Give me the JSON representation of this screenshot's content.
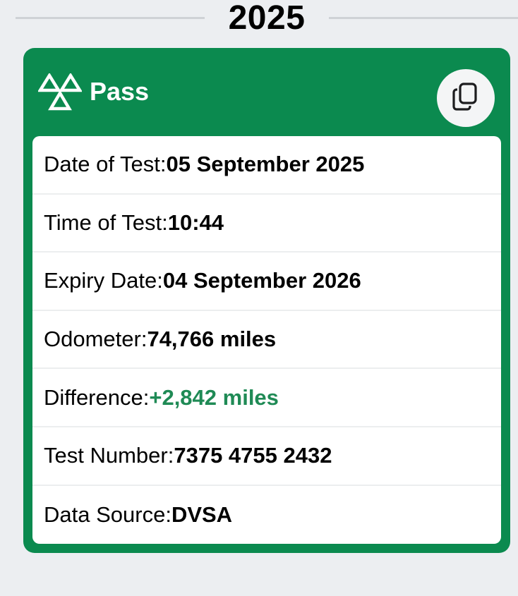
{
  "year": "2025",
  "card": {
    "status": "Pass",
    "colors": {
      "accent": "#0b8a4f",
      "positive": "#1f8a55"
    },
    "icons": {
      "status_icon": "mot-triangles-icon",
      "copy_icon": "copy-icon"
    },
    "rows": [
      {
        "label": "Date of Test: ",
        "value": "05 September 2025"
      },
      {
        "label": "Time of Test: ",
        "value": "10:44"
      },
      {
        "label": "Expiry Date: ",
        "value": "04 September 2026"
      },
      {
        "label": "Odometer: ",
        "value": "74,766 miles"
      },
      {
        "label": "Difference: ",
        "value": "+2,842 miles"
      },
      {
        "label": "Test Number: ",
        "value": "7375 4755 2432"
      },
      {
        "label": "Data Source: ",
        "value": "DVSA"
      }
    ]
  }
}
